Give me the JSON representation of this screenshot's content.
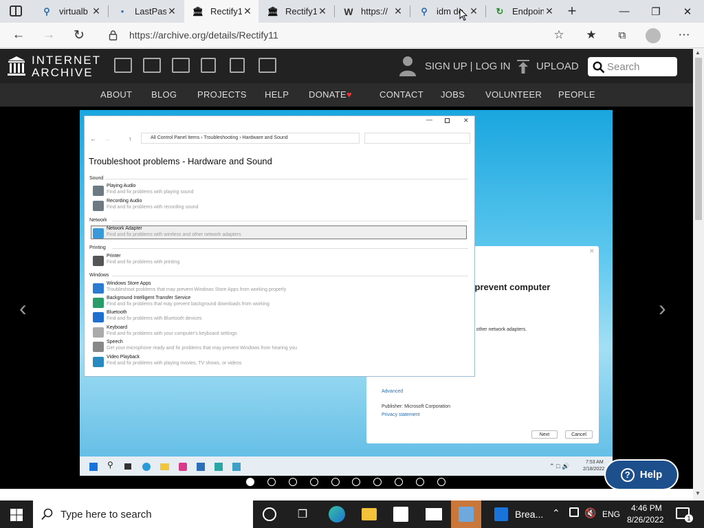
{
  "browser": {
    "tabs": [
      {
        "label": "virtualb",
        "icon": "search-icon"
      },
      {
        "label": "LastPass",
        "icon": "lastpass-icon"
      },
      {
        "label": "Rectify1",
        "icon": "archive-icon",
        "active": true
      },
      {
        "label": "Rectify1",
        "icon": "archive-icon"
      },
      {
        "label": "https://",
        "icon": "wordpress-icon"
      },
      {
        "label": "idm do",
        "icon": "search-icon"
      },
      {
        "label": "Endpoin",
        "icon": "loading-icon"
      }
    ],
    "url": "https://archive.org/details/Rectify11"
  },
  "ia": {
    "logo_line1": "INTERNET",
    "logo_line2": "ARCHIVE",
    "signup": "SIGN UP | LOG IN",
    "upload": "UPLOAD",
    "search_placeholder": "Search",
    "nav": [
      "ABOUT",
      "BLOG",
      "PROJECTS",
      "HELP",
      "DONATE",
      "CONTACT",
      "JOBS",
      "VOLUNTEER",
      "PEOPLE"
    ],
    "heart_color": "#e33"
  },
  "viewer": {
    "control_panel": {
      "breadcrumb": [
        "All Control Panel Items",
        "Troubleshooting",
        "Hardware and Sound"
      ],
      "title": "Troubleshoot problems - Hardware and Sound",
      "categories": [
        {
          "name": "Sound",
          "items": [
            {
              "name": "Playing Audio",
              "desc": "Find and fix problems with playing sound"
            },
            {
              "name": "Recording Audio",
              "desc": "Find and fix problems with recording sound"
            }
          ]
        },
        {
          "name": "Network",
          "items": [
            {
              "name": "Network Adapter",
              "desc": "Find and fix problems with wireless and other network adapters"
            }
          ]
        },
        {
          "name": "Printing",
          "items": [
            {
              "name": "Printer",
              "desc": "Find and fix problems with printing"
            }
          ]
        },
        {
          "name": "Windows",
          "items": [
            {
              "name": "Windows Store Apps",
              "desc": "Troubleshoot problems that may prevent Windows Store Apps from working properly"
            },
            {
              "name": "Background Intelligent Transfer Service",
              "desc": "Find and fix problems that may prevent background downloads from working"
            },
            {
              "name": "Bluetooth",
              "desc": "Find and fix problems with Bluetooth devices"
            },
            {
              "name": "Keyboard",
              "desc": "Find and fix problems with your computer's keyboard settings"
            },
            {
              "name": "Speech",
              "desc": "Get your microphone ready and fix problems that may prevent Windows from hearing you"
            },
            {
              "name": "Video Playback",
              "desc": "Find and fix problems with playing movies, TV shows, or videos"
            }
          ]
        }
      ]
    },
    "wizard": {
      "heading": "p prevent computer",
      "text": "and other network adapters.",
      "advanced": "Advanced",
      "publisher": "Publisher:  Microsoft Corporation",
      "privacy": "Privacy statement",
      "next": "Next",
      "cancel": "Cancel"
    },
    "inner_clock": "7:53 AM",
    "inner_date": "2/18/2022",
    "slides_total": 10,
    "slide_current": 1,
    "help_label": "Help"
  },
  "taskbar": {
    "search_placeholder": "Type here to search",
    "app_label": "Brea...",
    "lang": "ENG",
    "time": "4:46 PM",
    "date": "8/26/2022",
    "notif_count": "1"
  }
}
